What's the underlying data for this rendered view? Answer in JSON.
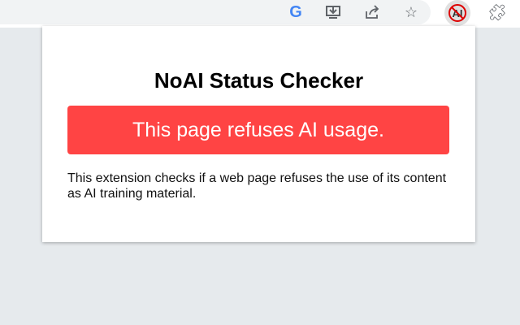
{
  "toolbar": {
    "icons": [
      "google-icon",
      "install-icon",
      "share-icon",
      "star-icon",
      "noai-extension-icon",
      "extensions-puzzle-icon"
    ],
    "noai_label": "AI"
  },
  "popup": {
    "title": "NoAI Status Checker",
    "status": "This page refuses AI usage.",
    "status_color": "#ff4444",
    "description": "This extension checks if a web page refuses the use of its content as AI training material."
  }
}
